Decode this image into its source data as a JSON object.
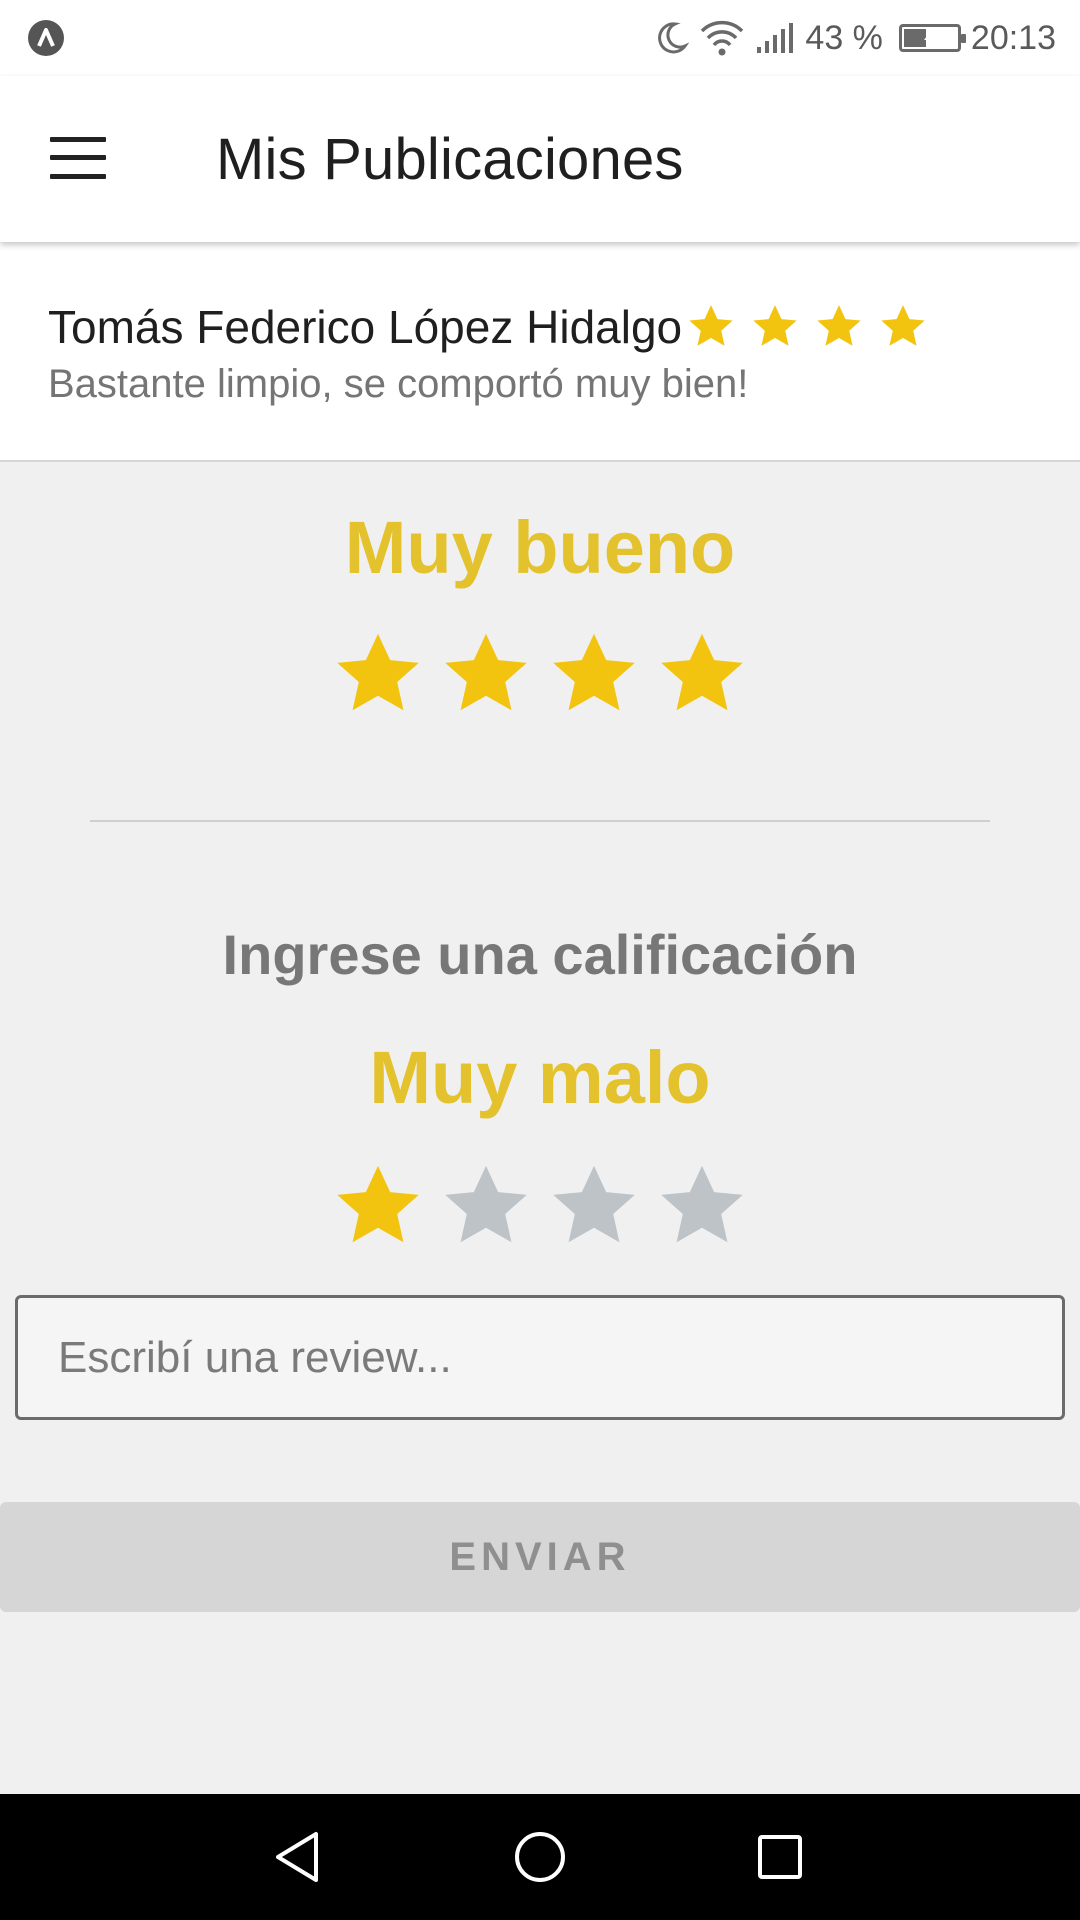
{
  "status_bar": {
    "battery_percent": "43 %",
    "battery_level": 0.43,
    "time": "20:13",
    "icons": [
      "app-notification-icon",
      "moon-icon",
      "wifi-icon",
      "signal-icon",
      "battery-charging-icon"
    ]
  },
  "app_bar": {
    "title": "Mis Publicaciones",
    "menu_icon": "hamburger-menu-icon"
  },
  "review": {
    "author": "Tomás Federico López Hidalgo",
    "text": "Bastante limpio, se comportó muy bien!",
    "stars": 4,
    "max_stars": 4
  },
  "average_rating": {
    "label": "Muy bueno",
    "stars": 4,
    "max_stars": 4
  },
  "rating_input": {
    "prompt": "Ingrese una calificación",
    "label": "Muy malo",
    "stars": 1,
    "max_stars": 4
  },
  "review_input": {
    "placeholder": "Escribí una review...",
    "value": ""
  },
  "submit_button": {
    "label": "ENVIAR"
  },
  "nav_bar": {
    "icons": [
      "back-icon",
      "home-icon",
      "recents-icon"
    ]
  },
  "colors": {
    "star_filled": "#f2c40f",
    "star_empty": "#bdc3c7",
    "label_accent": "#e3c22e",
    "button_disabled_bg": "#d6d6d6"
  }
}
